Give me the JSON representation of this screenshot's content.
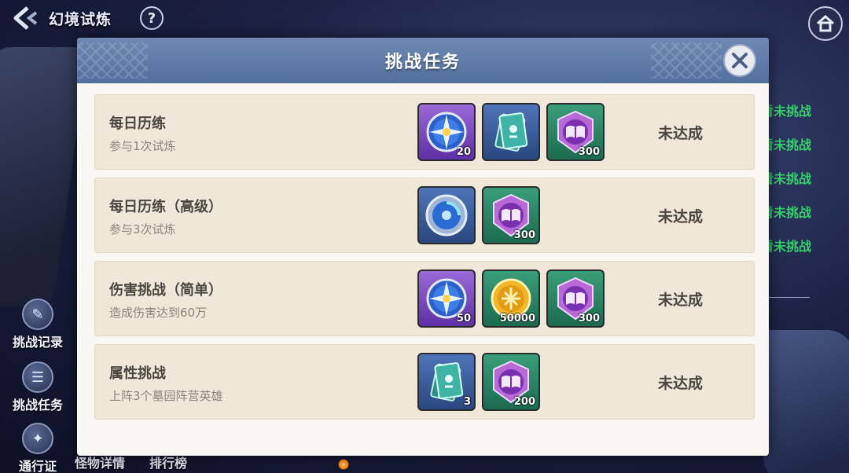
{
  "topbar": {
    "title": "幻境试炼",
    "help": "?"
  },
  "side_menu": [
    {
      "label": "挑战记录",
      "icon": "scroll-icon"
    },
    {
      "label": "挑战任务",
      "icon": "quest-icon"
    },
    {
      "label": "通行证",
      "icon": "pass-icon"
    }
  ],
  "bottom_tabs": [
    "怪物详情",
    "排行榜"
  ],
  "background_list": [
    "看未挑战",
    "看未挑战",
    "看未挑战",
    "看未挑战",
    "看未挑战"
  ],
  "modal": {
    "title": "挑战任务",
    "tasks": [
      {
        "name": "每日历练",
        "desc": "参与1次试炼",
        "status": "未达成",
        "rewards": [
          {
            "icon": "compass-star-icon",
            "frame": "purple",
            "qty": "20"
          },
          {
            "icon": "ticket-card-icon",
            "frame": "blue",
            "qty": ""
          },
          {
            "icon": "book-emblem-icon",
            "frame": "green",
            "qty": "300"
          }
        ]
      },
      {
        "name": "每日历练（高级）",
        "desc": "参与3次试炼",
        "status": "未达成",
        "rewards": [
          {
            "icon": "compass-orb-icon",
            "frame": "blue",
            "qty": ""
          },
          {
            "icon": "book-emblem-icon",
            "frame": "green",
            "qty": "300"
          }
        ]
      },
      {
        "name": "伤害挑战（简单）",
        "desc": "造成伤害达到60万",
        "status": "未达成",
        "rewards": [
          {
            "icon": "compass-star-icon",
            "frame": "purple",
            "qty": "50"
          },
          {
            "icon": "gold-coin-icon",
            "frame": "green",
            "qty": "50000"
          },
          {
            "icon": "book-emblem-icon",
            "frame": "green",
            "qty": "300"
          }
        ]
      },
      {
        "name": "属性挑战",
        "desc": "上阵3个墓园阵营英雄",
        "status": "未达成",
        "rewards": [
          {
            "icon": "ticket-card-icon",
            "frame": "blue",
            "qty": "3"
          },
          {
            "icon": "book-emblem-icon",
            "frame": "green",
            "qty": "200"
          }
        ]
      }
    ]
  },
  "colors": {
    "header": "#5f7ca9",
    "row_bg": "#efe8d8",
    "status_green": "#36d16a"
  }
}
